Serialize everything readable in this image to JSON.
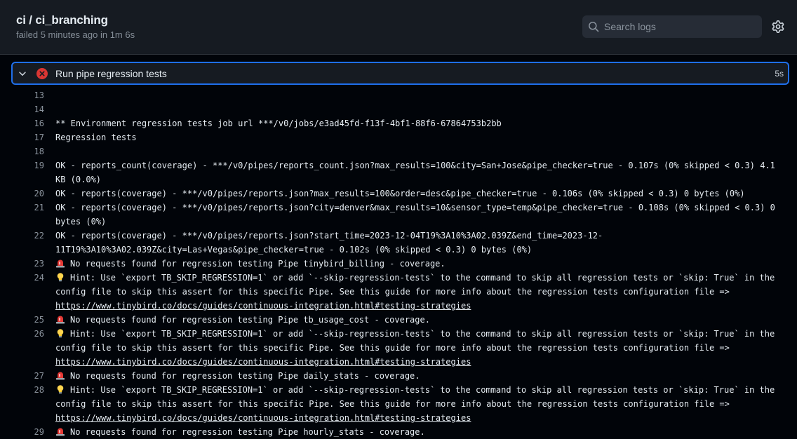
{
  "header": {
    "title": "ci / ci_branching",
    "subtitle": "failed 5 minutes ago in 1m 6s"
  },
  "search": {
    "placeholder": "Search logs",
    "icon": "search-icon"
  },
  "settings": {
    "icon": "gear-icon"
  },
  "step": {
    "title": "Run pipe regression tests",
    "duration": "5s",
    "status": "failed",
    "status_color": "#da3633",
    "accent": "#1f6feb"
  },
  "log": {
    "lines": [
      {
        "n": "13",
        "text": ""
      },
      {
        "n": "14",
        "text": ""
      },
      {
        "n": "16",
        "text": "** Environment regression tests job url ***/v0/jobs/e3ad45fd-f13f-4bf1-88f6-67864753b2bb"
      },
      {
        "n": "17",
        "text": "Regression tests"
      },
      {
        "n": "18",
        "text": ""
      },
      {
        "n": "19",
        "text": "OK - reports_count(coverage) - ***/v0/pipes/reports_count.json?max_results=100&city=San+Jose&pipe_checker=true - 0.107s (0% skipped < 0.3) 4.1 KB (0.0%)"
      },
      {
        "n": "20",
        "text": "OK - reports(coverage) - ***/v0/pipes/reports.json?max_results=100&order=desc&pipe_checker=true - 0.106s (0% skipped < 0.3) 0 bytes (0%)"
      },
      {
        "n": "21",
        "text": "OK - reports(coverage) - ***/v0/pipes/reports.json?city=denver&max_results=10&sensor_type=temp&pipe_checker=true - 0.108s (0% skipped < 0.3) 0 bytes (0%)"
      },
      {
        "n": "22",
        "text": "OK - reports(coverage) - ***/v0/pipes/reports.json?start_time=2023-12-04T19%3A10%3A02.039Z&end_time=2023-12-\n11T19%3A10%3A02.039Z&city=Las+Vegas&pipe_checker=true - 0.102s (0% skipped < 0.3) 0 bytes (0%)"
      },
      {
        "n": "23",
        "text": "No requests found for regression testing Pipe tinybird_billing - coverage."
      },
      {
        "n": "24",
        "text": "Hint: Use `export TB_SKIP_REGRESSION=1` or add `--skip-regression-tests` to the command to skip all regression tests or `skip: True` in the config file to skip this assert for this specific Pipe. See this guide for more info about the regression tests configuration file =>",
        "link": "https://www.tinybird.co/docs/guides/continuous-integration.html#testing-strategies"
      },
      {
        "n": "25",
        "text": "No requests found for regression testing Pipe tb_usage_cost - coverage."
      },
      {
        "n": "26",
        "text": "Hint: Use `export TB_SKIP_REGRESSION=1` or add `--skip-regression-tests` to the command to skip all regression tests or `skip: True` in the config file to skip this assert for this specific Pipe. See this guide for more info about the regression tests configuration file =>",
        "link": "https://www.tinybird.co/docs/guides/continuous-integration.html#testing-strategies"
      },
      {
        "n": "27",
        "text": "No requests found for regression testing Pipe daily_stats - coverage."
      },
      {
        "n": "28",
        "text": "Hint: Use `export TB_SKIP_REGRESSION=1` or add `--skip-regression-tests` to the command to skip all regression tests or `skip: True` in the config file to skip this assert for this specific Pipe. See this guide for more info about the regression tests configuration file =>",
        "link": "https://www.tinybird.co/docs/guides/continuous-integration.html#testing-strategies"
      },
      {
        "n": "29",
        "text": "No requests found for regression testing Pipe hourly_stats - coverage."
      }
    ]
  }
}
